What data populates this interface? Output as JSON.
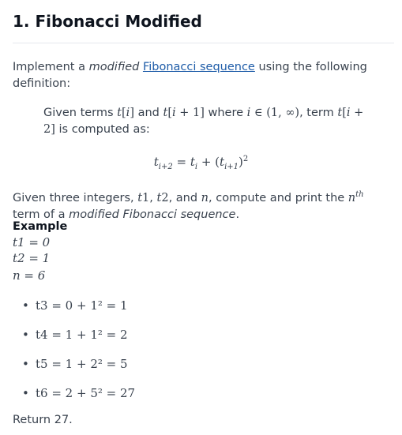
{
  "title": "1. Fibonacci Modified",
  "intro": {
    "prefix": "Implement a ",
    "modified": "modified",
    "link": "Fibonacci sequence",
    "suffix": " using the following definition:"
  },
  "given": {
    "t1": "Given terms ",
    "and": " and ",
    "where": " where ",
    "term": ", term",
    "computed": " is computed as:"
  },
  "task": {
    "text1": "Given three integers, ",
    "text2": ", and ",
    "text3": ", compute and print the ",
    "text4": " term of a ",
    "modified_seq": "modified Fibonacci sequence",
    "end": "."
  },
  "example": {
    "label": "Example",
    "t1": "t1 = 0",
    "t2": "t2 = 1",
    "n": "n = 6"
  },
  "bullets": [
    "t3 = 0 + 1² = 1",
    "t4 = 1 + 1² = 2",
    "t5 = 1 + 2² = 5",
    "t6 = 2 + 5² = 27"
  ],
  "return": "Return 27."
}
